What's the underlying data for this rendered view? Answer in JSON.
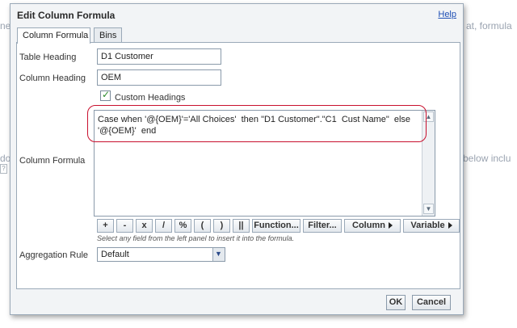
{
  "background": {
    "text_1": "at, formula",
    "text_2": "below inclu",
    "text_3": "do",
    "text_4": "ne"
  },
  "dialog": {
    "title": "Edit Column Formula",
    "help_label": "Help",
    "tabs": [
      {
        "label": "Column Formula",
        "active": true
      },
      {
        "label": "Bins",
        "active": false
      }
    ],
    "table_heading": {
      "label": "Table Heading",
      "value": "D1 Customer"
    },
    "column_heading": {
      "label": "Column Heading",
      "value": "OEM"
    },
    "custom_headings": {
      "label": "Custom Headings",
      "checked": true
    },
    "column_formula": {
      "label": "Column Formula",
      "value": "Case when '@{OEM}'='All Choices'  then \"D1 Customer\".\"C1  Cust Name\"  else\n'@{OEM}'  end"
    },
    "operators": [
      "+",
      "-",
      "x",
      "/",
      "%",
      "(",
      ")",
      "||"
    ],
    "function_label": "Function...",
    "filter_label": "Filter...",
    "column_label": "Column",
    "variable_label": "Variable",
    "hint": "Select any field from the left panel to insert it into the formula.",
    "aggregation": {
      "label": "Aggregation Rule",
      "value": "Default"
    },
    "ok_label": "OK",
    "cancel_label": "Cancel"
  },
  "colors": {
    "highlight_oval": "#c8102e",
    "link": "#1f4fb5",
    "checkmark": "#2a8a2a"
  }
}
